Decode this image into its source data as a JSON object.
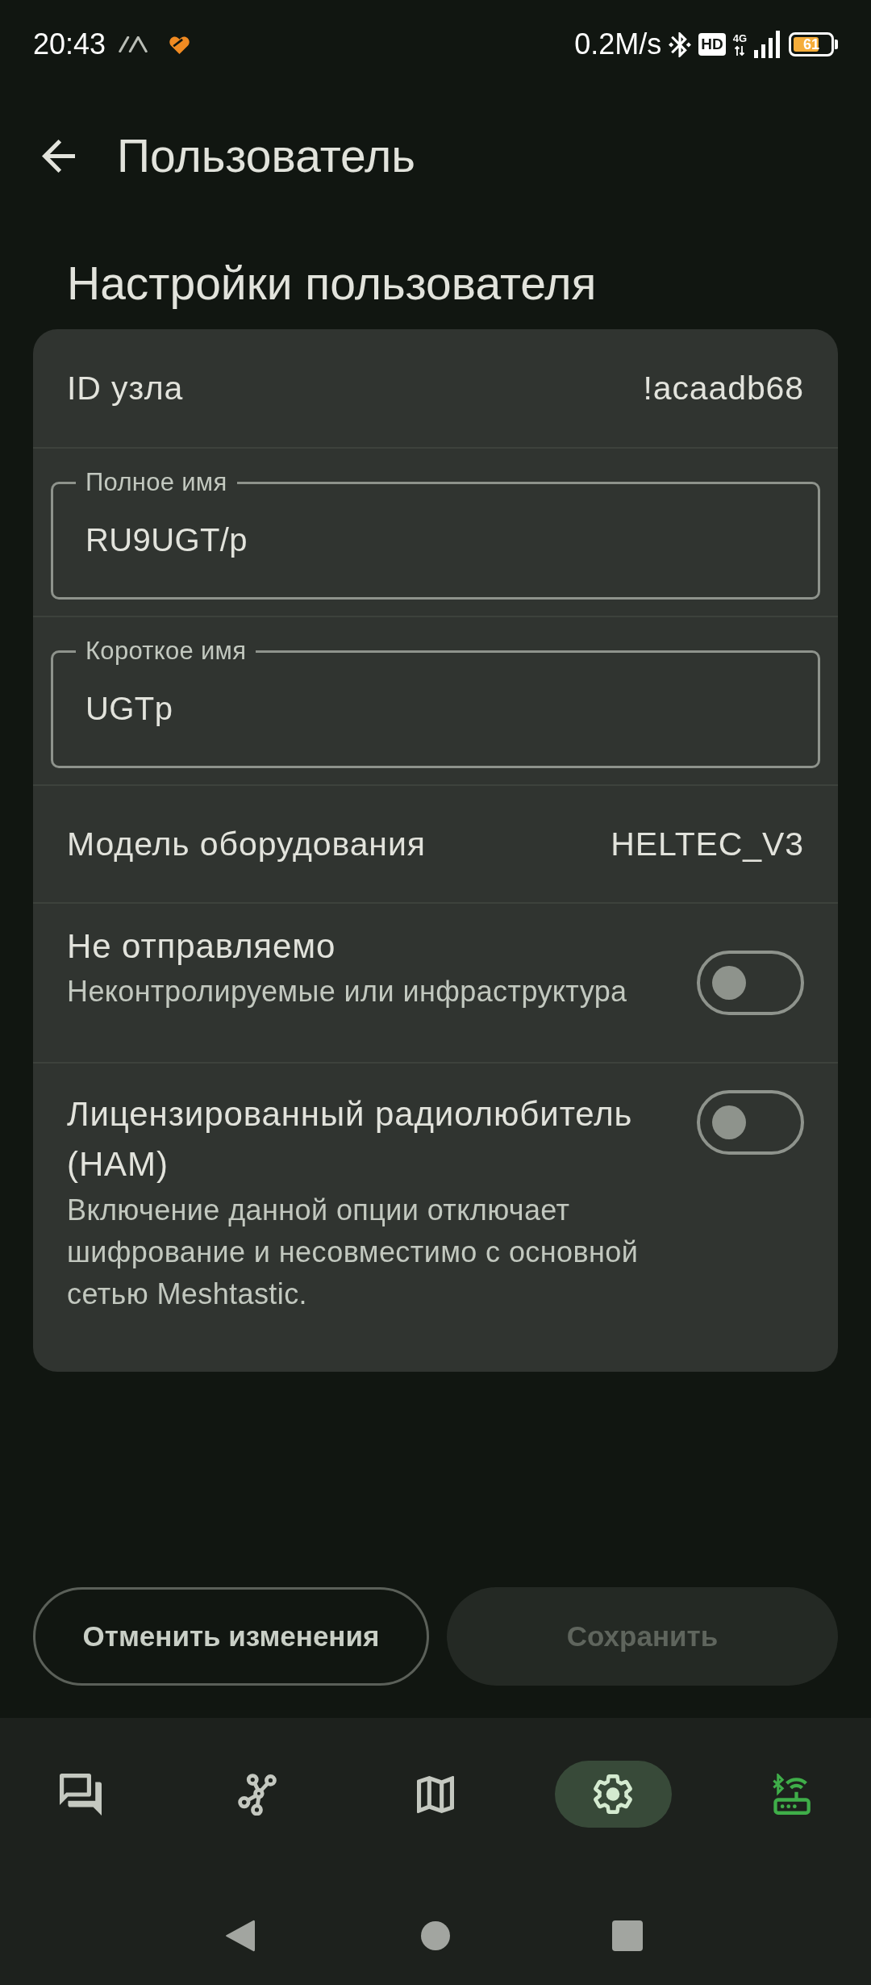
{
  "status_bar": {
    "time": "20:43",
    "net_speed": "0.2M/s",
    "hd_label": "HD",
    "network_type": "4G",
    "battery": "61"
  },
  "top_bar": {
    "title": "Пользователь"
  },
  "section": {
    "title": "Настройки пользователя",
    "rows": [
      {
        "kind": "info",
        "label": "ID узла",
        "value": "!acaadb68"
      },
      {
        "kind": "text_field",
        "label": "Полное имя",
        "value": "RU9UGT/p"
      },
      {
        "kind": "text_field",
        "label": "Короткое имя",
        "value": "UGTp"
      },
      {
        "kind": "info",
        "label": "Модель оборудования",
        "value": "HELTEC_V3"
      },
      {
        "kind": "toggle",
        "title": "Не отправляемо",
        "subtitle": "Неконтролируемые или инфраструктура",
        "on": false
      },
      {
        "kind": "toggle_note",
        "title": "Лицензированный радиолюбитель (HAM)",
        "subtitle": "Включение данной опции отключает шифрование и несовместимо с основной сетью Meshtastic.",
        "on": false
      }
    ]
  },
  "actions": [
    {
      "kind": "outlined",
      "label": "Отменить изменения",
      "disabled": false
    },
    {
      "kind": "filled",
      "label": "Сохранить",
      "disabled": true
    }
  ],
  "bottom_nav": {
    "items": [
      {
        "kind": "messages",
        "selected": false
      },
      {
        "kind": "nodes",
        "selected": false
      },
      {
        "kind": "map",
        "selected": false
      },
      {
        "kind": "settings",
        "selected": true
      },
      {
        "kind": "connection",
        "selected": false,
        "connected": true
      }
    ]
  }
}
